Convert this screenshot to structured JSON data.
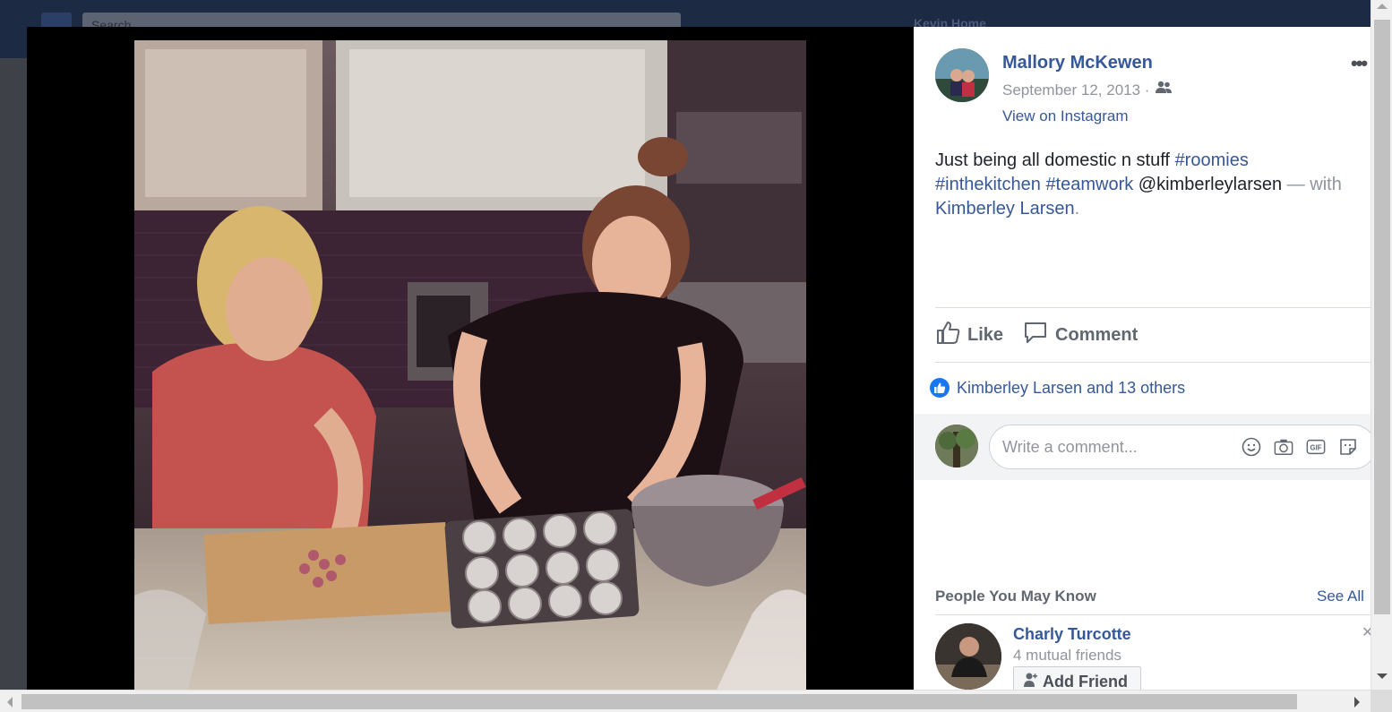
{
  "header": {
    "search_placeholder": "Search",
    "nav_text": "Kevin    Home"
  },
  "post": {
    "author": "Mallory McKewen",
    "date": "September 12, 2013 ·",
    "audience_icon": "friends-icon",
    "instagram_link": "View on Instagram",
    "more_label": "•••",
    "caption": {
      "text": "Just being all domestic n stuff ",
      "hashtag_1": "#roomies",
      "hashtag_2": "#inthekitchen",
      "hashtag_3": "#teamwork",
      "mention": " @kimberleylarsen ",
      "with_text": "— with",
      "tagged": "Kimberley Larsen",
      "period": "."
    },
    "actions": {
      "like": "Like",
      "comment": "Comment"
    },
    "reactions_text": "Kimberley Larsen and 13 others",
    "comment_placeholder": "Write a comment...",
    "comment_icons": [
      "emoji-icon",
      "camera-icon",
      "gif-icon",
      "sticker-icon"
    ]
  },
  "people_you_may_know": {
    "title": "People You May Know",
    "see_all": "See All",
    "people": [
      {
        "name": "Charly Turcotte",
        "mutual": "4 mutual friends",
        "button": "Add Friend"
      }
    ]
  },
  "colors": {
    "link": "#365899",
    "muted": "#90949c",
    "like_badge": "#1877f2"
  }
}
